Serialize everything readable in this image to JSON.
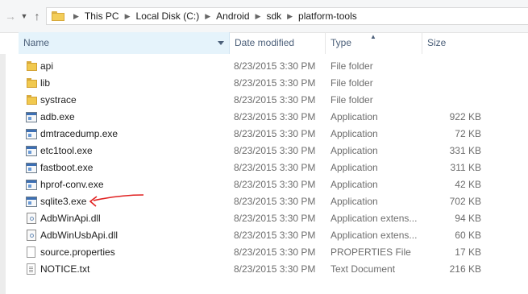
{
  "nav": {
    "forward_icon": "forward-arrow-icon",
    "dropdown_icon": "chevron-down-icon",
    "up_icon": "up-arrow-icon"
  },
  "address": {
    "crumbs": [
      "This PC",
      "Local Disk (C:)",
      "Android",
      "sdk",
      "platform-tools"
    ]
  },
  "columns": {
    "name": "Name",
    "date": "Date modified",
    "type": "Type",
    "size": "Size",
    "sort_indicator": "▲"
  },
  "files": [
    {
      "icon": "folder-icon",
      "name": "api",
      "date": "8/23/2015 3:30 PM",
      "type": "File folder",
      "size": ""
    },
    {
      "icon": "folder-icon",
      "name": "lib",
      "date": "8/23/2015 3:30 PM",
      "type": "File folder",
      "size": ""
    },
    {
      "icon": "folder-icon",
      "name": "systrace",
      "date": "8/23/2015 3:30 PM",
      "type": "File folder",
      "size": ""
    },
    {
      "icon": "application-icon",
      "name": "adb.exe",
      "date": "8/23/2015 3:30 PM",
      "type": "Application",
      "size": "922 KB"
    },
    {
      "icon": "application-icon",
      "name": "dmtracedump.exe",
      "date": "8/23/2015 3:30 PM",
      "type": "Application",
      "size": "72 KB"
    },
    {
      "icon": "application-icon",
      "name": "etc1tool.exe",
      "date": "8/23/2015 3:30 PM",
      "type": "Application",
      "size": "331 KB"
    },
    {
      "icon": "application-icon",
      "name": "fastboot.exe",
      "date": "8/23/2015 3:30 PM",
      "type": "Application",
      "size": "311 KB"
    },
    {
      "icon": "application-icon",
      "name": "hprof-conv.exe",
      "date": "8/23/2015 3:30 PM",
      "type": "Application",
      "size": "42 KB"
    },
    {
      "icon": "application-icon",
      "name": "sqlite3.exe",
      "date": "8/23/2015 3:30 PM",
      "type": "Application",
      "size": "702 KB"
    },
    {
      "icon": "dll-icon",
      "name": "AdbWinApi.dll",
      "date": "8/23/2015 3:30 PM",
      "type": "Application extens...",
      "size": "94 KB"
    },
    {
      "icon": "dll-icon",
      "name": "AdbWinUsbApi.dll",
      "date": "8/23/2015 3:30 PM",
      "type": "Application extens...",
      "size": "60 KB"
    },
    {
      "icon": "file-icon",
      "name": "source.properties",
      "date": "8/23/2015 3:30 PM",
      "type": "PROPERTIES File",
      "size": "17 KB"
    },
    {
      "icon": "text-document-icon",
      "name": "NOTICE.txt",
      "date": "8/23/2015 3:30 PM",
      "type": "Text Document",
      "size": "216 KB"
    }
  ],
  "annotation": {
    "icon": "red-arrow-annotation",
    "color": "#e02020"
  }
}
